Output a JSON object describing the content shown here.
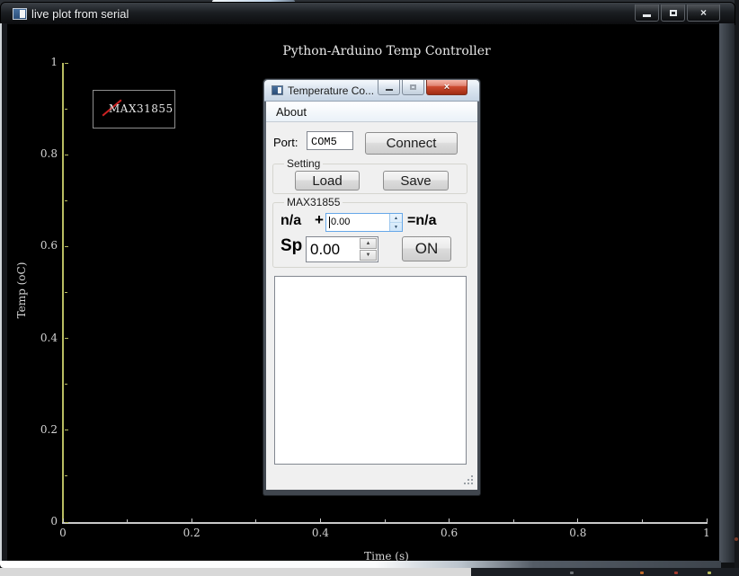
{
  "chart_data": {
    "type": "line",
    "title": "Python-Arduino Temp Controller",
    "xlabel": "Time (s)",
    "ylabel": "Temp (oC)",
    "xlim": [
      0,
      1
    ],
    "ylim": [
      0,
      1
    ],
    "xticks": [
      "0",
      "0.2",
      "0.4",
      "0.6",
      "0.8",
      "1"
    ],
    "yticks": [
      "0",
      "0.2",
      "0.4",
      "0.6",
      "0.8",
      "1"
    ],
    "grid": false,
    "legend_position": "upper-left",
    "series": [
      {
        "name": "MAX31855",
        "color": "#cc2222",
        "x": [],
        "y": []
      }
    ]
  },
  "main_window": {
    "title": "live plot from serial",
    "icons": {
      "app": "tk-app-icon",
      "minimize": "minimize-icon",
      "maximize": "maximize-icon",
      "close": "close-icon"
    },
    "close_glyph": "×"
  },
  "dialog": {
    "title": "Temperature Co...",
    "close_glyph": "×",
    "menu": [
      "About"
    ],
    "port_label": "Port:",
    "port_value": "COM5",
    "connect_label": "Connect",
    "setting_group": {
      "label": "Setting",
      "load_label": "Load",
      "save_label": "Save"
    },
    "max31855_group": {
      "label": "MAX31855",
      "current_value": "n/a",
      "plus": "+",
      "offset_value": "0.00",
      "equals_result": "=n/a",
      "sp_label": "Sp",
      "sp_value": "0.00",
      "on_label": "ON",
      "spin_up": "▲",
      "spin_down": "▼"
    },
    "log_text": ""
  },
  "colors": {
    "axis_y": "#b9bd62",
    "axis_x": "#c9c9c9",
    "tick_label": "#d4d4d4",
    "legend_line": "#cc2222",
    "close_red": "#cf4d32"
  }
}
